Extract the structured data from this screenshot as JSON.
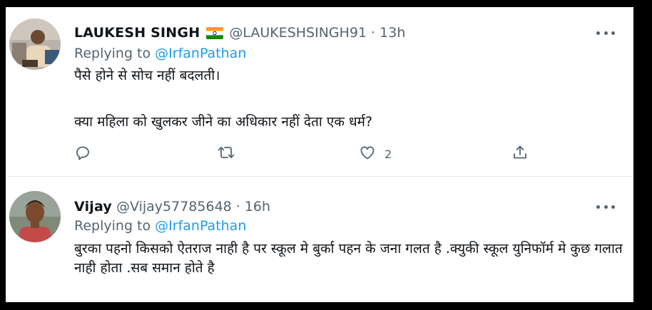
{
  "tweets": [
    {
      "name": "LAUKESH SINGH",
      "flag_icon": "india-flag-icon",
      "handle": "@LAUKESHSINGH91",
      "separator": "·",
      "time": "13h",
      "replying_prefix": "Replying to ",
      "replying_to": "@IrfanPathan",
      "body_lines": [
        "पैसे होने से सोच नहीं बदलती।",
        "क्या  महिला को खुलकर जीने का अधिकार नहीं देता एक धर्म?"
      ],
      "actions": {
        "reply_icon": "reply-icon",
        "retweet_icon": "retweet-icon",
        "like_icon": "heart-icon",
        "like_count": "2",
        "share_icon": "share-icon"
      }
    },
    {
      "name": "Vijay",
      "handle": "@Vijay57785648",
      "separator": "·",
      "time": "16h",
      "replying_prefix": "Replying to ",
      "replying_to": "@IrfanPathan",
      "body": "बुरका पहनो किसको ऐतराज नाही है पर स्कूल मे बुर्का पहन के जना गलत है .क्युकी स्कूल युनिफॉर्म मे कुछ गलात नाही होता .सब समान होते है"
    }
  ],
  "colors": {
    "text": "#0f1419",
    "secondary": "#536471",
    "link": "#1d9bf0",
    "divider": "#e6ecf0"
  }
}
